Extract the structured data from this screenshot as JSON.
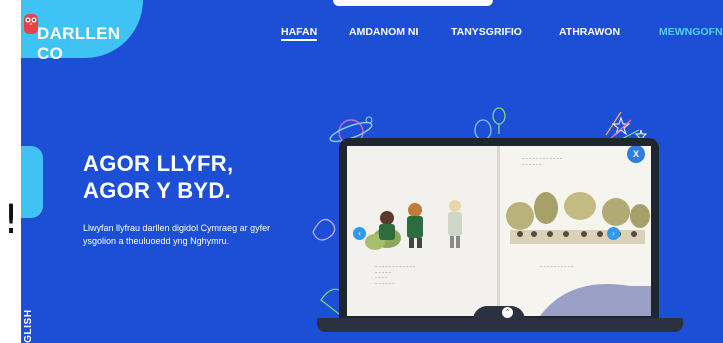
{
  "brand": {
    "name": "DARLLEN CO"
  },
  "nav": {
    "items": [
      {
        "label": "HAFAN"
      },
      {
        "label": "AMDANOM NI"
      },
      {
        "label": "TANYSGRIFIO"
      },
      {
        "label": "ATHRAWON"
      },
      {
        "label": "MEWNGOFNOD"
      }
    ]
  },
  "language_tab": {
    "label": "ENGLISH"
  },
  "hero": {
    "headline_line1": "AGOR LLYFR,",
    "headline_line2": "AGOR Y BYD.",
    "description": "Llwyfan llyfrau darllen digidol Cymraeg ar gyfer ysgolion a theuluoedd yng Nghymru."
  },
  "book_viewer": {
    "close_label": "X"
  },
  "side_text": "!",
  "colors": {
    "hero_bg": "#1c4fd6",
    "accent_cyan": "#3ec3f4",
    "login_link": "#4ed3ff"
  }
}
